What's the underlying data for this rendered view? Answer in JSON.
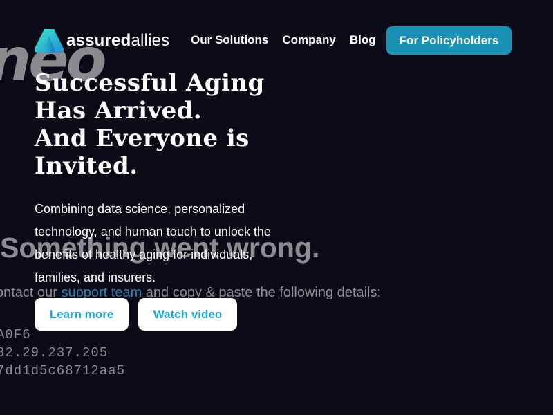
{
  "background": {
    "logo_text": "neo",
    "error_title": "Something went wrong.",
    "contact_prefix": "ontact our ",
    "contact_link": "support team",
    "contact_suffix": " and copy & paste the following details:",
    "code_lines": [
      "A0F6",
      "82.29.237.205",
      "7dd1d5c68712aa5"
    ]
  },
  "brand": {
    "name_part1": "assured",
    "name_part2": "allies",
    "logo_icon": "triangle-logo-icon",
    "colors": {
      "gradient_start": "#35e0c7",
      "gradient_end": "#1f8fd8"
    }
  },
  "nav": {
    "items": [
      {
        "label": "Our Solutions"
      },
      {
        "label": "Company"
      },
      {
        "label": "Blog"
      }
    ],
    "cta_label": "For Policyholders"
  },
  "hero": {
    "title_lines": [
      "Successful Aging",
      "Has Arrived.",
      "And Everyone is",
      "Invited."
    ],
    "description": "Combining data science, personalized technology, and human touch to unlock the benefits of healthy aging for individuals, families, and insurers.",
    "learn_more_label": "Learn more",
    "watch_video_label": "Watch video"
  },
  "colors": {
    "background": "#0b0a17",
    "accent": "#1a92b6",
    "button_text": "#1aa7d6"
  }
}
